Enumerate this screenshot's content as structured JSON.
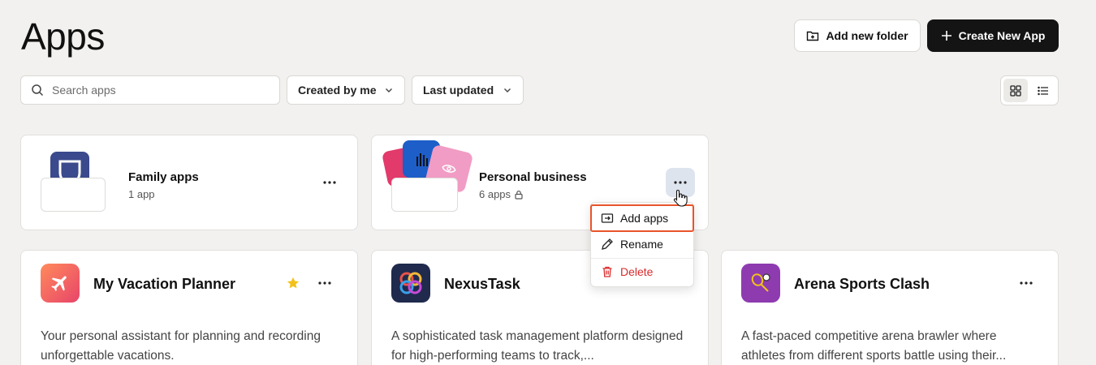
{
  "header": {
    "title": "Apps",
    "add_folder_label": "Add new folder",
    "create_app_label": "Create New App"
  },
  "filters": {
    "search_placeholder": "Search apps",
    "created_by": "Created by me",
    "sort": "Last updated"
  },
  "folders": [
    {
      "name": "Family apps",
      "count": "1 app",
      "locked": false
    },
    {
      "name": "Personal business",
      "count": "6 apps",
      "locked": true
    }
  ],
  "context_menu": {
    "items": [
      {
        "label": "Add apps"
      },
      {
        "label": "Rename"
      },
      {
        "label": "Delete"
      }
    ]
  },
  "apps": [
    {
      "name": "My Vacation Planner",
      "description": "Your personal assistant for planning and recording unforgettable vacations.",
      "starred": true
    },
    {
      "name": "NexusTask",
      "description": "A sophisticated task management platform designed for high-performing teams to track,...",
      "starred": false
    },
    {
      "name": "Arena Sports Clash",
      "description": "A fast-paced competitive arena brawler where athletes from different sports battle using their...",
      "starred": false
    }
  ],
  "colors": {
    "accent_dark": "#141414",
    "highlight_outline": "#e8542a",
    "danger": "#d92a2a",
    "star": "#f2c21b"
  }
}
